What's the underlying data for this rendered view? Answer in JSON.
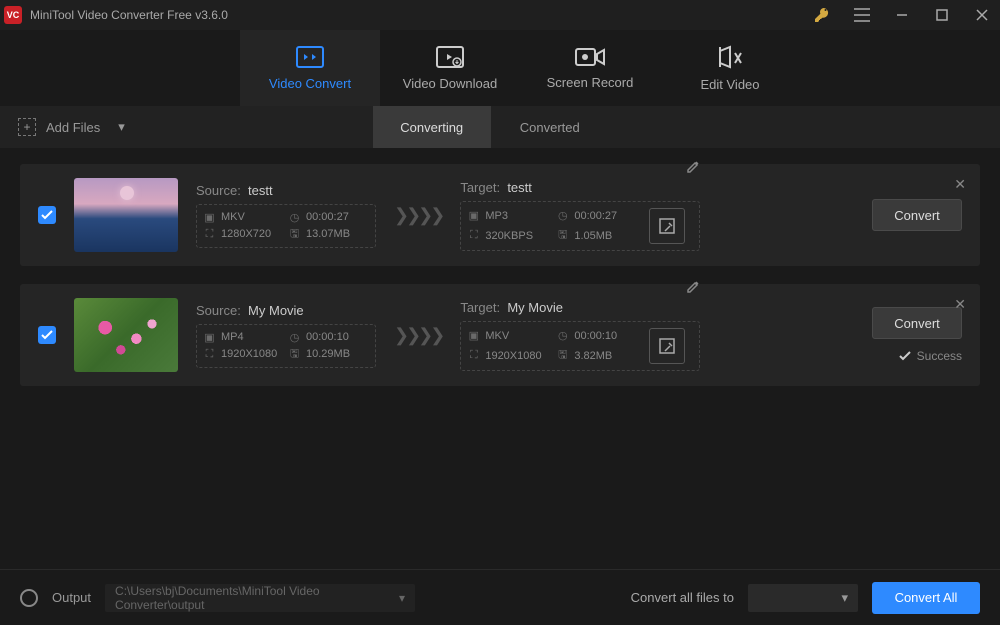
{
  "title": "MiniTool Video Converter Free v3.6.0",
  "nav": {
    "convert": "Video Convert",
    "download": "Video Download",
    "record": "Screen Record",
    "edit": "Edit Video"
  },
  "toolbar": {
    "add_files": "Add Files"
  },
  "subtabs": {
    "converting": "Converting",
    "converted": "Converted"
  },
  "items": [
    {
      "source_label": "Source:",
      "source_name": "testt",
      "src_format": "MKV",
      "src_duration": "00:00:27",
      "src_res": "1280X720",
      "src_size": "13.07MB",
      "target_label": "Target:",
      "target_name": "testt",
      "tgt_format": "MP3",
      "tgt_duration": "00:00:27",
      "tgt_res": "320KBPS",
      "tgt_size": "1.05MB",
      "convert_label": "Convert",
      "status": ""
    },
    {
      "source_label": "Source:",
      "source_name": "My Movie",
      "src_format": "MP4",
      "src_duration": "00:00:10",
      "src_res": "1920X1080",
      "src_size": "10.29MB",
      "target_label": "Target:",
      "target_name": "My Movie",
      "tgt_format": "MKV",
      "tgt_duration": "00:00:10",
      "tgt_res": "1920X1080",
      "tgt_size": "3.82MB",
      "convert_label": "Convert",
      "status": "Success"
    }
  ],
  "footer": {
    "output_label": "Output",
    "output_path": "C:\\Users\\bj\\Documents\\MiniTool Video Converter\\output",
    "all_to_label": "Convert all files to",
    "convert_all": "Convert All"
  }
}
